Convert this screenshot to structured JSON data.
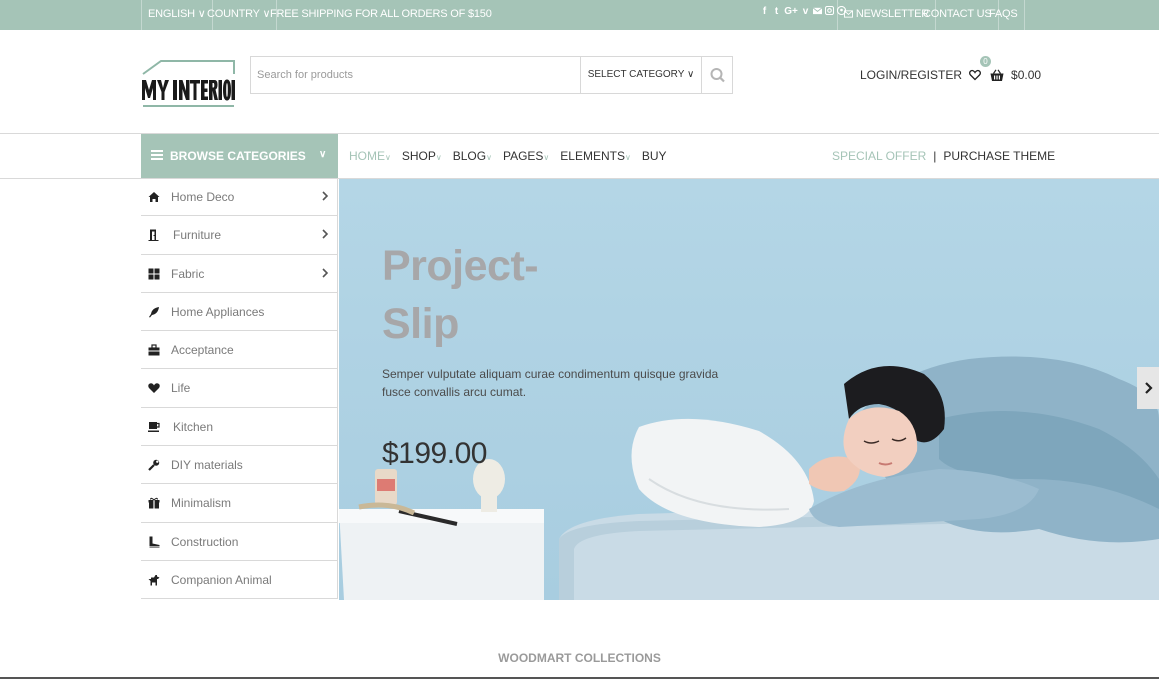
{
  "topbar": {
    "language": "ENGLISH ∨",
    "country": "COUNTRY ∨",
    "shipping": "FREE SHIPPING FOR ALL ORDERS OF $150",
    "newsletter": "NEWSLETTER",
    "contact": "CONTACT US",
    "faqs": "FAQS"
  },
  "header": {
    "logo_text": "MY INTERIOR",
    "search_placeholder": "Search for products",
    "select_category": "SELECT CATEGORY ∨",
    "login": "LOGIN/REGISTER",
    "cart_count": "0",
    "cart_total": "$0.00"
  },
  "nav": {
    "browse": "BROWSE CATEGORIES",
    "browse_caret": "∨",
    "items": [
      {
        "label": "HOME"
      },
      {
        "label": "SHOP"
      },
      {
        "label": "BLOG"
      },
      {
        "label": "PAGES"
      },
      {
        "label": "ELEMENTS"
      },
      {
        "label": "BUY"
      }
    ],
    "caret": "∨",
    "special_offer": "SPECIAL OFFER",
    "separator": "|",
    "purchase": "PURCHASE THEME"
  },
  "categories": [
    {
      "label": "Home Deco"
    },
    {
      "label": "Furniture"
    },
    {
      "label": "Fabric"
    },
    {
      "label": "Home Appliances"
    },
    {
      "label": "Acceptance"
    },
    {
      "label": "Life"
    },
    {
      "label": "Kitchen"
    },
    {
      "label": "DIY materials"
    },
    {
      "label": "Minimalism"
    },
    {
      "label": "Construction"
    },
    {
      "label": "Companion Animal"
    }
  ],
  "hero": {
    "title_line1": "Project-",
    "title_line2": "Slip",
    "description": "Semper vulputate aliquam curae condimentum quisque gravida fusce convallis arcu cumat.",
    "price": "$199.00"
  },
  "section": {
    "collections": "WOODMART COLLECTIONS"
  },
  "colors": {
    "accent": "#a5c4b7",
    "hero_bg": "#b6d7e6"
  }
}
